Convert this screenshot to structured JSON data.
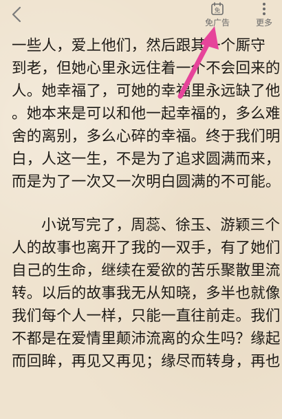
{
  "topbar": {
    "back_icon": "chevron-left-icon",
    "adfree": {
      "icon_char": "免",
      "label": "免广告"
    },
    "more": {
      "label": "更多"
    }
  },
  "content": {
    "paragraph1": [
      "一些人，爱上他们，然后跟其一个厮守",
      "到老，但她心里永远住着一个不会回来的",
      "人。她幸福了，可她的幸福里永远缺了他",
      "。她本来是可以和他一起幸福的，多么难",
      "舍的离别，多么心碎的幸福。终于我们明",
      "白，人这一生，不是为了追求圆满而来，",
      "而是为了一次又一次明白圆满的不可能。"
    ],
    "paragraph2": [
      "小说写完了，周蕊、徐玉、游颖三个",
      "人的故事也离开了我的一双手，有了她们",
      "自己的生命，继续在爱欲的苦乐聚散里流",
      "转。以后的故事我无从知晓，多半也就像",
      "我们每个人一样，只能一直往前走。我们",
      "不都是在爱情里颠沛流离的众生吗？缘起",
      "而回眸，再见又再见；缘尽而转身，再也"
    ]
  },
  "annotation": {
    "arrow_color": "#e6449a"
  }
}
